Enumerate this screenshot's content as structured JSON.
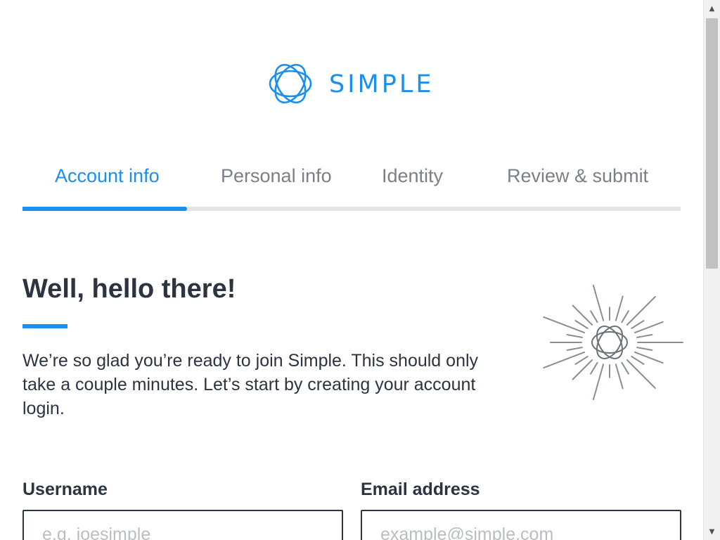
{
  "brand": {
    "name": "SIMPLE",
    "color": "#1b8ff0"
  },
  "steps": [
    {
      "label": "Account info",
      "active": true
    },
    {
      "label": "Personal info",
      "active": false
    },
    {
      "label": "Identity",
      "active": false
    },
    {
      "label": "Review & submit",
      "active": false
    }
  ],
  "progress": {
    "current_step": 1,
    "total_steps": 4,
    "fraction": 0.25
  },
  "intro": {
    "headline": "Well, hello there!",
    "body": "We’re so glad you’re ready to join Simple. This should only take a couple minutes. Let’s start by creating your account login."
  },
  "illustration": {
    "icon": "sunburst-logo-icon"
  },
  "form": {
    "username": {
      "label": "Username",
      "placeholder": "e.g. joesimple",
      "value": ""
    },
    "email": {
      "label": "Email address",
      "placeholder": "example@simple.com",
      "value": ""
    }
  },
  "colors": {
    "accent": "#1b8ff0",
    "text": "#2b3440",
    "muted": "#7a8087",
    "track": "#e2e4e6"
  },
  "scrollbar": {
    "up_icon": "scroll-up-arrow-icon",
    "down_icon": "scroll-down-arrow-icon"
  }
}
